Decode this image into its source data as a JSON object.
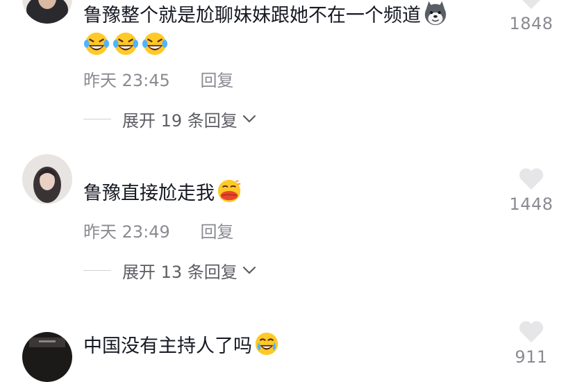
{
  "comments": [
    {
      "text": "鲁豫整个就是尬聊妹妹跟她不在一个频道",
      "emojis_inline": [
        "husky-dog-emoji"
      ],
      "emojis_line2": [
        "rolling-laugh-emoji",
        "rolling-laugh-emoji",
        "rolling-laugh-emoji"
      ],
      "time": "昨天 23:45",
      "reply_label": "回复",
      "expand_label": "展开 19 条回复",
      "likes": "1848"
    },
    {
      "text": "鲁豫直接尬走我",
      "emojis_inline": [
        "kiss-lips-emoji"
      ],
      "time": "昨天 23:49",
      "reply_label": "回复",
      "expand_label": "展开 13 条回复",
      "likes": "1448"
    },
    {
      "text": "中国没有主持人了吗",
      "emojis_inline": [
        "tears-of-joy-emoji"
      ],
      "likes": "911"
    }
  ],
  "colors": {
    "text": "#161823",
    "meta": "#8a8b91",
    "heart": "#e6e6e8"
  }
}
